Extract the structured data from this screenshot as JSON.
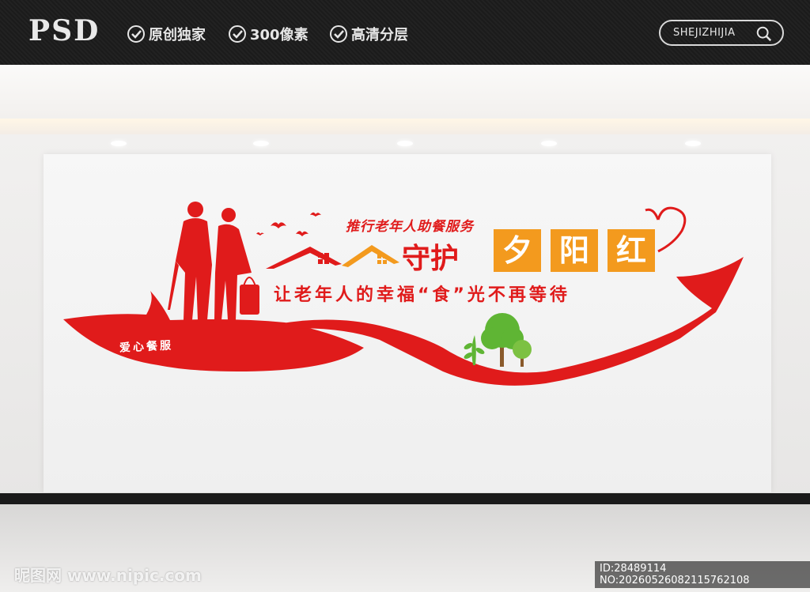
{
  "header": {
    "logo": "PSD",
    "features": [
      "原创独家",
      "300像素",
      "高清分层"
    ],
    "search_text": "SHEJIZHIJIA"
  },
  "wall": {
    "slogan_small": "推行老年人助餐服务",
    "slogan_big": "守护",
    "tag_chars": [
      "夕",
      "阳",
      "红"
    ],
    "subline": "让老年人的幸福“食”光不再等待",
    "ribbon_label": "爱心餐服"
  },
  "watermarks": {
    "site": "昵图网 www.nipic.com",
    "id_line": "ID:28489114 NO:20260526082115762108"
  },
  "colors": {
    "accent_red": "#e01b1b",
    "accent_orange": "#f39a1e",
    "tree_green": "#5fb534"
  }
}
